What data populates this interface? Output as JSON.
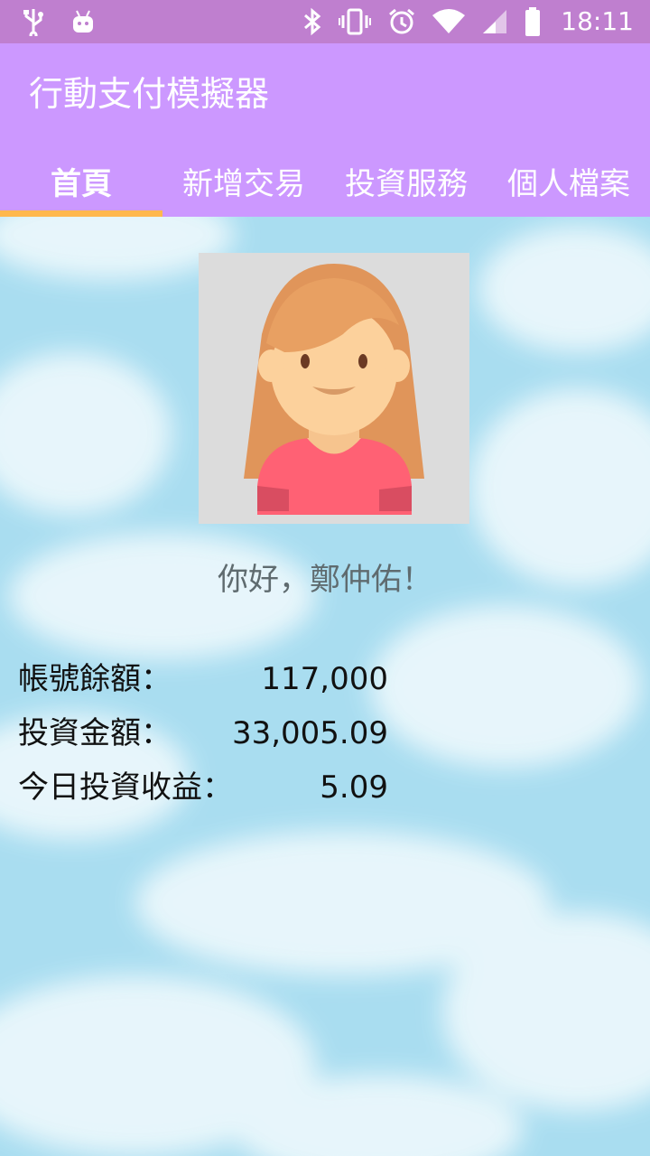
{
  "status_bar": {
    "time": "18:11",
    "icons": [
      "usb-icon",
      "android-debug-icon",
      "bluetooth-icon",
      "vibrate-icon",
      "alarm-icon",
      "wifi-icon",
      "signal-icon",
      "battery-icon"
    ]
  },
  "app": {
    "title": "行動支付模擬器",
    "tabs": [
      {
        "label": "首頁",
        "active": true
      },
      {
        "label": "新增交易",
        "active": false
      },
      {
        "label": "投資服務",
        "active": false
      },
      {
        "label": "個人檔案",
        "active": false
      }
    ]
  },
  "home": {
    "greeting": "你好，鄭仲佑！",
    "rows": [
      {
        "label": "帳號餘額：",
        "value": "117,000"
      },
      {
        "label": "投資金額：",
        "value": "33,005.09"
      },
      {
        "label": "今日投資收益：",
        "value": "5.09"
      }
    ]
  },
  "colors": {
    "status_bar": "#bf7fcf",
    "app_bar": "#cc98ff",
    "tab_indicator": "#ffb84d",
    "sky": "#a9ddf0"
  }
}
